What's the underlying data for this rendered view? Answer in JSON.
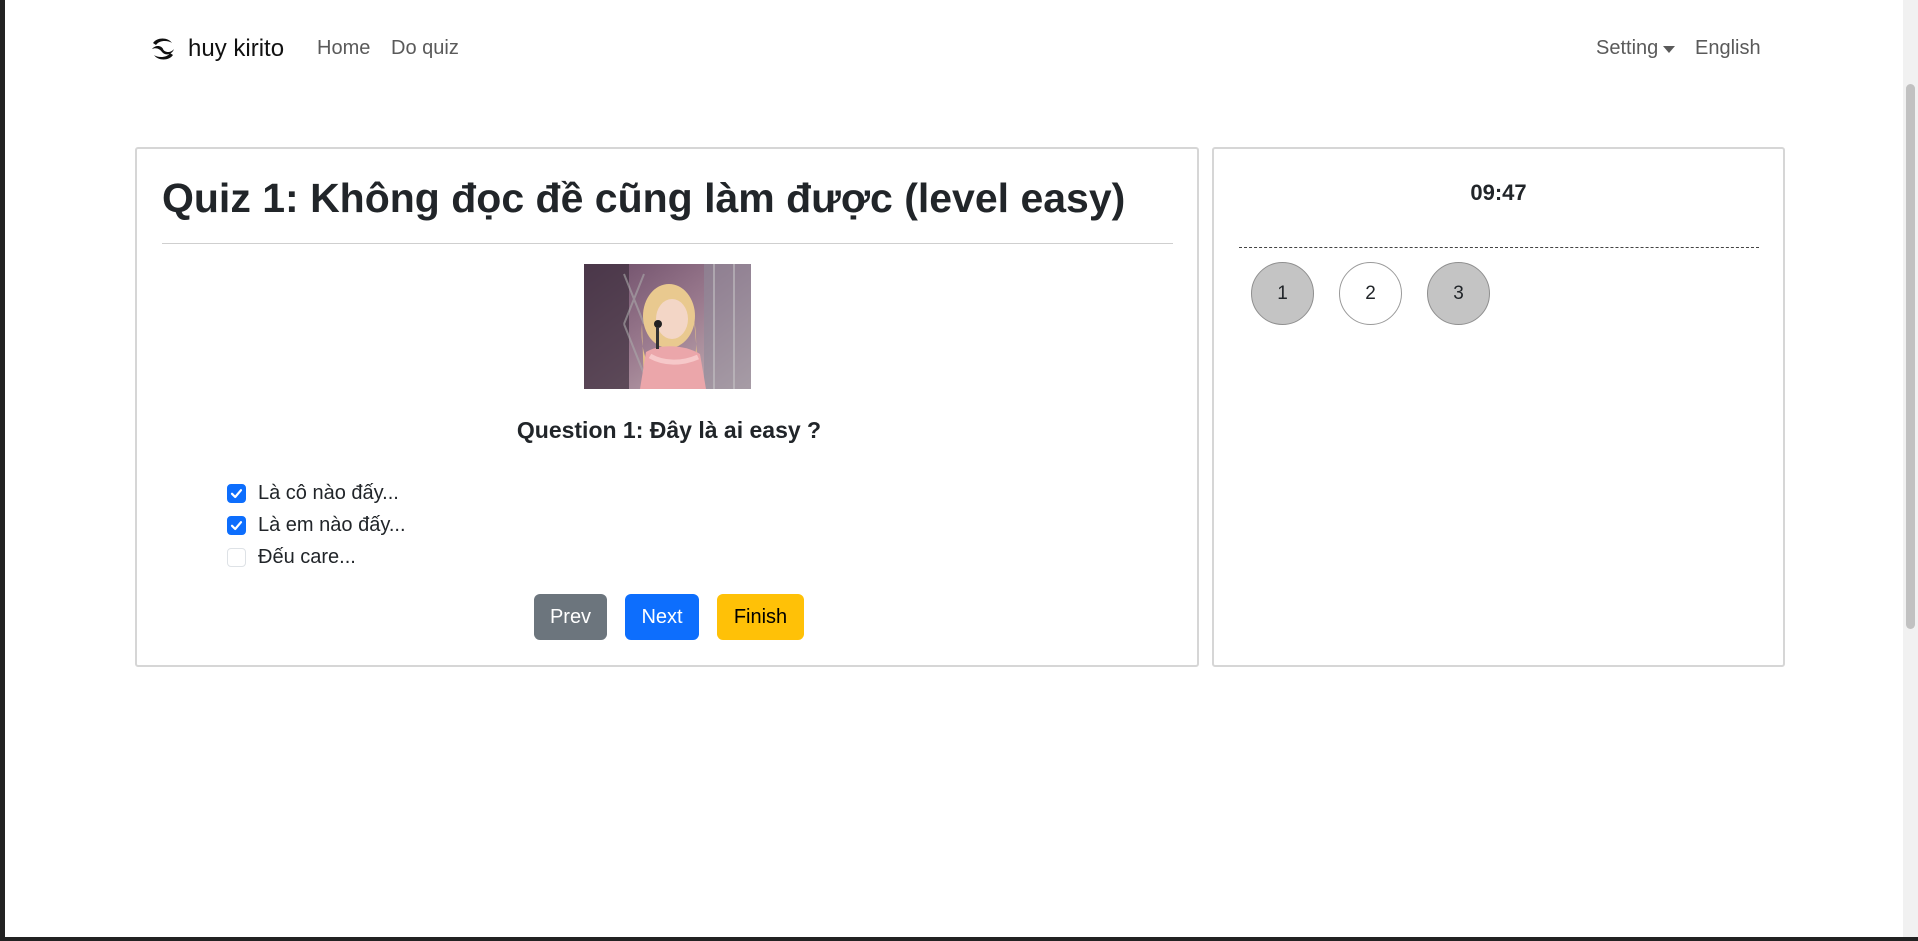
{
  "navbar": {
    "brand": "huy kirito",
    "links": [
      "Home",
      "Do quiz"
    ],
    "setting": "Setting",
    "language": "English"
  },
  "quiz": {
    "title": "Quiz 1: Không đọc đề cũng làm được (level easy)",
    "question": "Question 1: Đây là ai easy ?",
    "answers": [
      {
        "label": "Là cô nào đấy...",
        "checked": true
      },
      {
        "label": "Là em nào đấy...",
        "checked": true
      },
      {
        "label": "Đếu care...",
        "checked": false
      }
    ],
    "buttons": {
      "prev": "Prev",
      "next": "Next",
      "finish": "Finish"
    }
  },
  "sidebar": {
    "timer": "09:47",
    "questions": [
      {
        "number": "1",
        "answered": true
      },
      {
        "number": "2",
        "answered": false
      },
      {
        "number": "3",
        "answered": true
      }
    ]
  },
  "colors": {
    "primary": "#0d6efd",
    "secondary": "#6c757d",
    "warning": "#ffc107"
  }
}
